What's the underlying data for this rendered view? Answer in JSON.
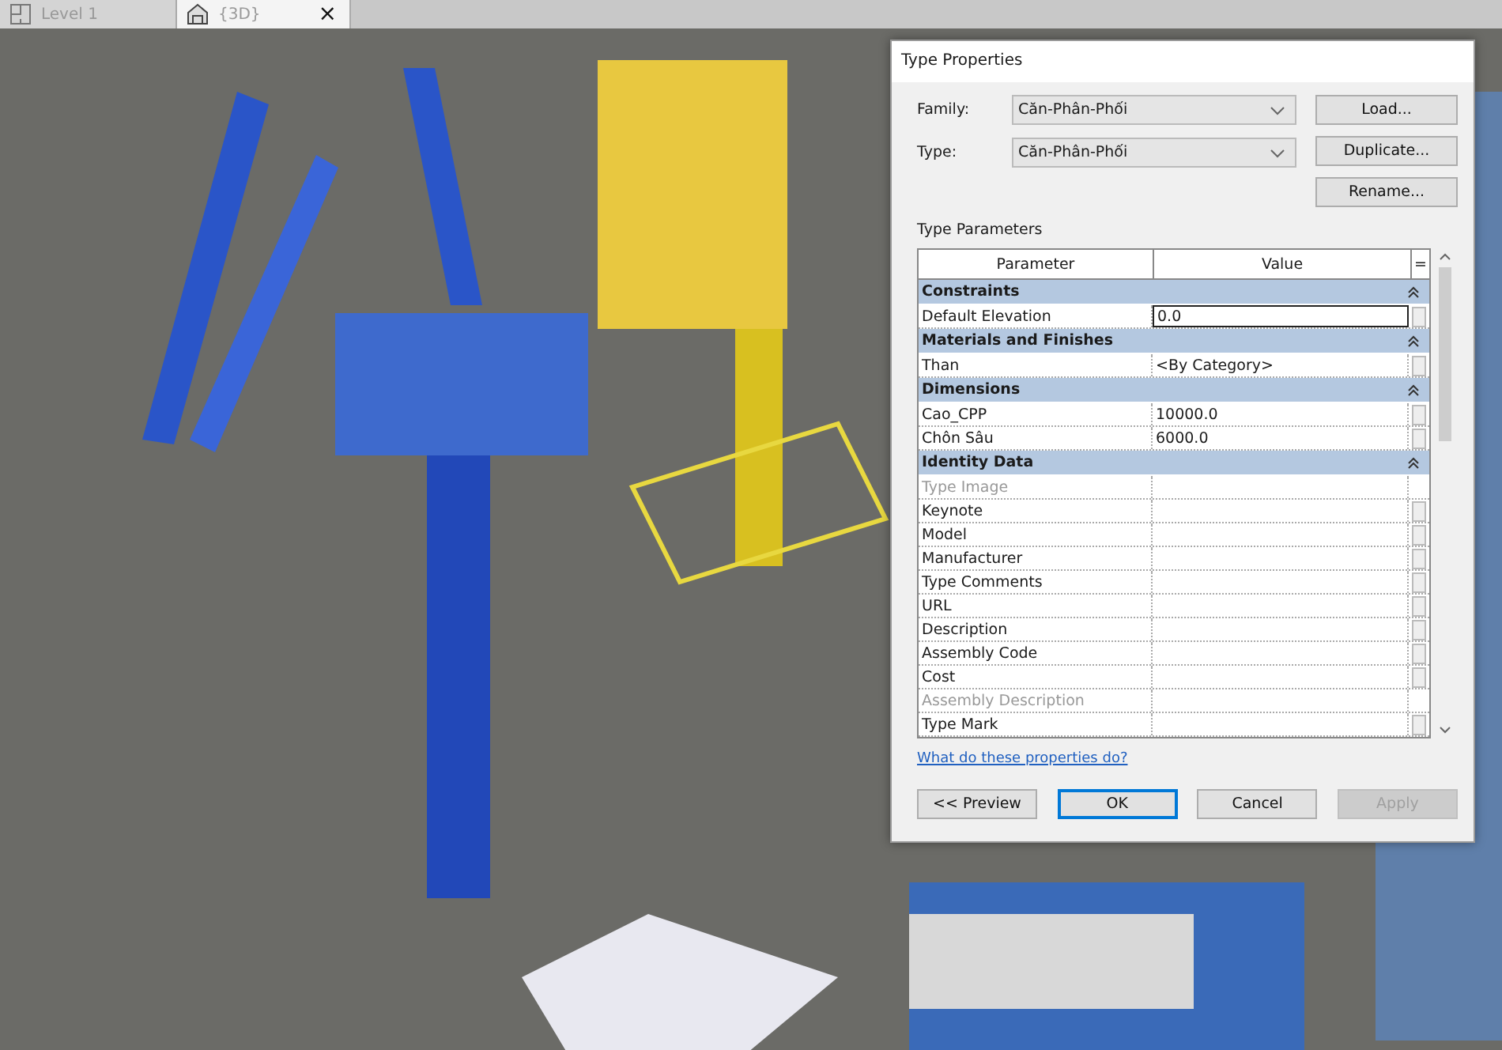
{
  "view_tabs": [
    {
      "label": "Level 1",
      "kind": "plan",
      "selected": false
    },
    {
      "label": "{3D}",
      "kind": "model",
      "selected": true,
      "close_glyph": "×"
    }
  ],
  "dialog": {
    "title": "Type Properties",
    "fields": [
      {
        "label": "Family:",
        "value": "Căn-Phân-Phối"
      },
      {
        "label": "Type:",
        "value": "Căn-Phân-Phối"
      }
    ],
    "side_buttons": [
      "Load...",
      "Duplicate...",
      "Rename..."
    ],
    "section_label": "Type Parameters",
    "table": {
      "columns": [
        "Parameter",
        "Value"
      ],
      "filter_glyph": "=",
      "groups": [
        {
          "name": "Constraints",
          "expanded": true,
          "rows": [
            {
              "parameter": "Default Elevation",
              "value": "0.0",
              "disabled": false,
              "active": true
            }
          ]
        },
        {
          "name": "Materials and Finishes",
          "expanded": true,
          "rows": [
            {
              "parameter": "Than",
              "value": "<By Category>",
              "disabled": false,
              "active": false
            }
          ]
        },
        {
          "name": "Dimensions",
          "expanded": true,
          "rows": [
            {
              "parameter": "Cao_CPP",
              "value": "10000.0",
              "disabled": false,
              "active": false
            },
            {
              "parameter": "Chôn Sâu",
              "value": "6000.0",
              "disabled": false,
              "active": false
            }
          ]
        },
        {
          "name": "Identity Data",
          "expanded": true,
          "rows": [
            {
              "parameter": "Type Image",
              "value": "",
              "disabled": true,
              "active": false
            },
            {
              "parameter": "Keynote",
              "value": "",
              "disabled": false,
              "active": false
            },
            {
              "parameter": "Model",
              "value": "",
              "disabled": false,
              "active": false
            },
            {
              "parameter": "Manufacturer",
              "value": "",
              "disabled": false,
              "active": false
            },
            {
              "parameter": "Type Comments",
              "value": "",
              "disabled": false,
              "active": false
            },
            {
              "parameter": "URL",
              "value": "",
              "disabled": false,
              "active": false
            },
            {
              "parameter": "Description",
              "value": "",
              "disabled": false,
              "active": false
            },
            {
              "parameter": "Assembly Code",
              "value": "",
              "disabled": false,
              "active": false
            },
            {
              "parameter": "Cost",
              "value": "",
              "disabled": false,
              "active": false
            },
            {
              "parameter": "Assembly Description",
              "value": "",
              "disabled": true,
              "active": false
            },
            {
              "parameter": "Type Mark",
              "value": "",
              "disabled": false,
              "active": false
            }
          ]
        }
      ]
    },
    "help_link": "What do these properties do?",
    "buttons": [
      {
        "label": "<< Preview",
        "kind": "secondary",
        "disabled": false
      },
      {
        "label": "OK",
        "kind": "default",
        "disabled": false
      },
      {
        "label": "Cancel",
        "kind": "secondary",
        "disabled": false
      },
      {
        "label": "Apply",
        "kind": "secondary",
        "disabled": true
      }
    ]
  }
}
